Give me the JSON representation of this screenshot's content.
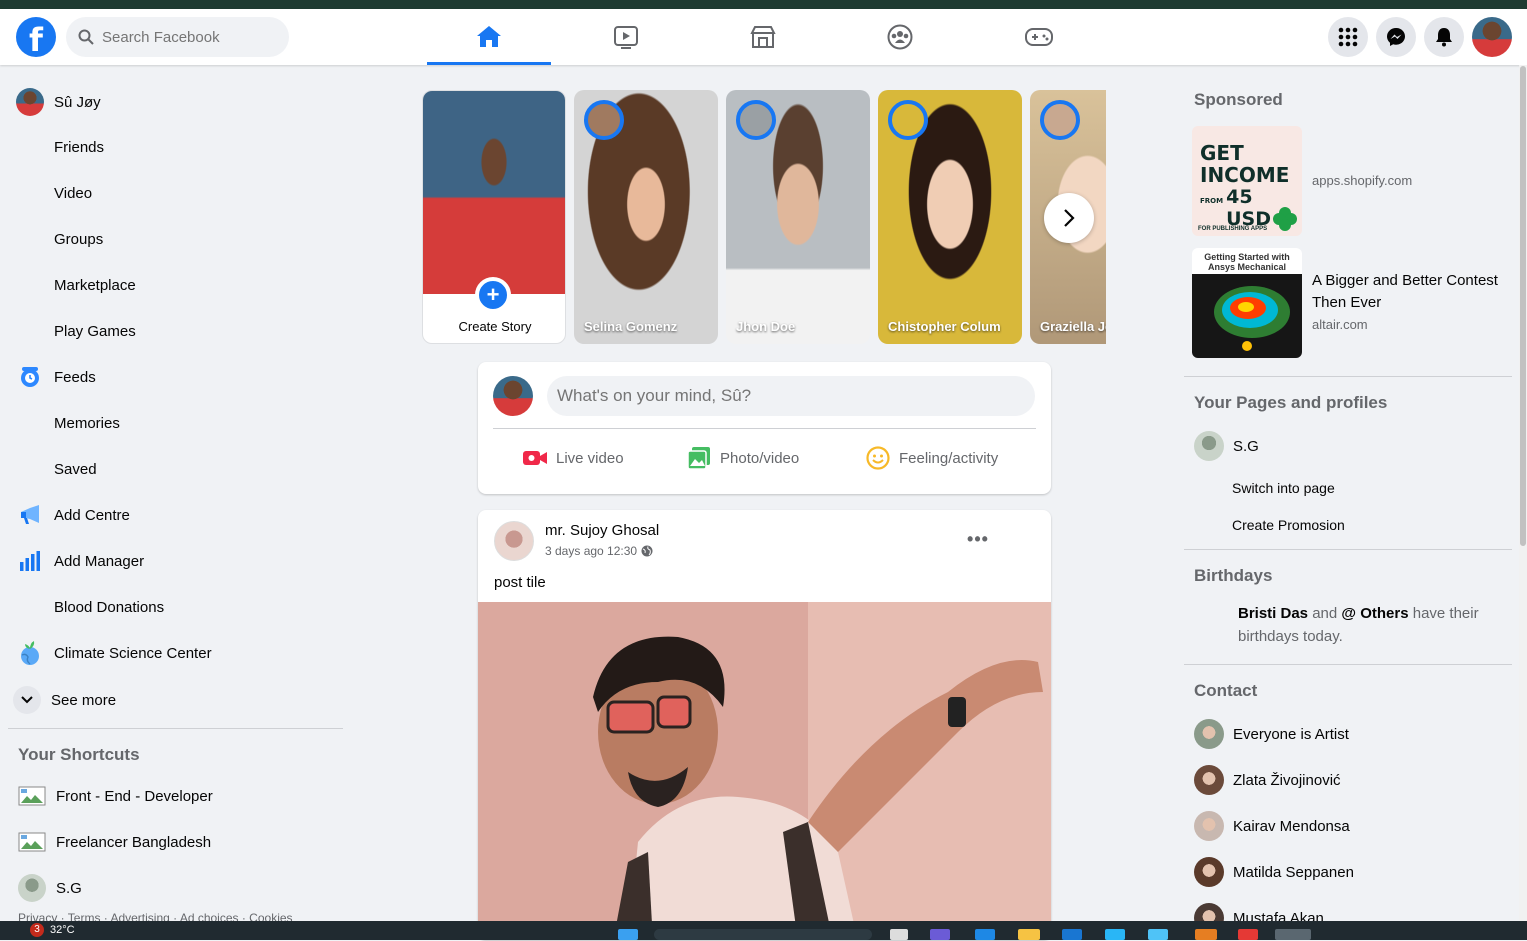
{
  "search": {
    "placeholder": "Search Facebook"
  },
  "logo": "f",
  "user": {
    "name": "Sû Jøy"
  },
  "left_nav": [
    {
      "label": "Friends",
      "icon": ""
    },
    {
      "label": "Video",
      "icon": ""
    },
    {
      "label": "Groups",
      "icon": ""
    },
    {
      "label": "Marketplace",
      "icon": ""
    },
    {
      "label": "Play Games",
      "icon": ""
    },
    {
      "label": "Feeds",
      "icon": "feeds-icon"
    },
    {
      "label": "Memories",
      "icon": ""
    },
    {
      "label": "Saved",
      "icon": ""
    },
    {
      "label": "Add Centre",
      "icon": "megaphone-icon"
    },
    {
      "label": "Add Manager",
      "icon": "bar-chart-icon"
    },
    {
      "label": "Blood Donations",
      "icon": ""
    },
    {
      "label": "Climate Science Center",
      "icon": "globe-plant-icon"
    }
  ],
  "see_more": "See more",
  "shortcuts": {
    "title": "Your Shortcuts",
    "items": [
      "Front - End - Developer",
      "Freelancer Bangladesh",
      "S.G"
    ]
  },
  "footer": "Privacy · Terms · Advertising · Ad choices · Cookies",
  "stories": {
    "create_label": "Create Story",
    "create_plus": "+",
    "items": [
      {
        "name": "Selina Gomenz",
        "color": "#a07a60"
      },
      {
        "name": "Jhon Doe",
        "color": "#9aa0a4"
      },
      {
        "name": "Chistopher Colum",
        "color": "#d8b83a"
      },
      {
        "name": "Graziella Je",
        "color": "#c8a890"
      }
    ]
  },
  "composer": {
    "placeholder": "What's on your mind, Sû?",
    "actions": [
      {
        "label": "Live video",
        "color": "#f02849"
      },
      {
        "label": "Photo/video",
        "color": "#45bd62"
      },
      {
        "label": "Feeling/activity",
        "color": "#f7b928"
      }
    ]
  },
  "post": {
    "author": "mr. Sujoy Ghosal",
    "time": "3 days ago 12:30",
    "text": "post tile",
    "more": "•••"
  },
  "sponsored": {
    "title": "Sponsored",
    "ads": [
      {
        "thumb_line1": "GET",
        "thumb_line2": "INCOME",
        "thumb_line3": "FROM",
        "thumb_line4": "45 USD",
        "thumb_line5": "FOR PUBLISHING APPS",
        "title": "",
        "url": "apps.shopify.com"
      },
      {
        "thumb_line1": "Getting Started with",
        "thumb_line2": "Ansys Mechanical",
        "title": "A Bigger and Better Contest Then Ever",
        "url": "altair.com"
      }
    ]
  },
  "pages": {
    "title": "Your Pages and profiles",
    "name": "S.G",
    "switch": "Switch into page",
    "promo": "Create Promosion"
  },
  "birthdays": {
    "title": "Birthdays",
    "name1": "Bristi Das",
    "and": " and ",
    "name2": "@ Others",
    "rest": " have their birthdays today."
  },
  "contacts": {
    "title": "Contact",
    "items": [
      "Everyone is Artist",
      "Zlata Živojinović",
      "Kairav Mendonsa",
      "Matilda Seppanen",
      "Mustafa Akan"
    ]
  },
  "taskbar": {
    "badge": "3",
    "temp": "32°C"
  },
  "colors": {
    "accent": "#1877f2",
    "bg": "#f0f2f5",
    "text_secondary": "#65676b"
  }
}
